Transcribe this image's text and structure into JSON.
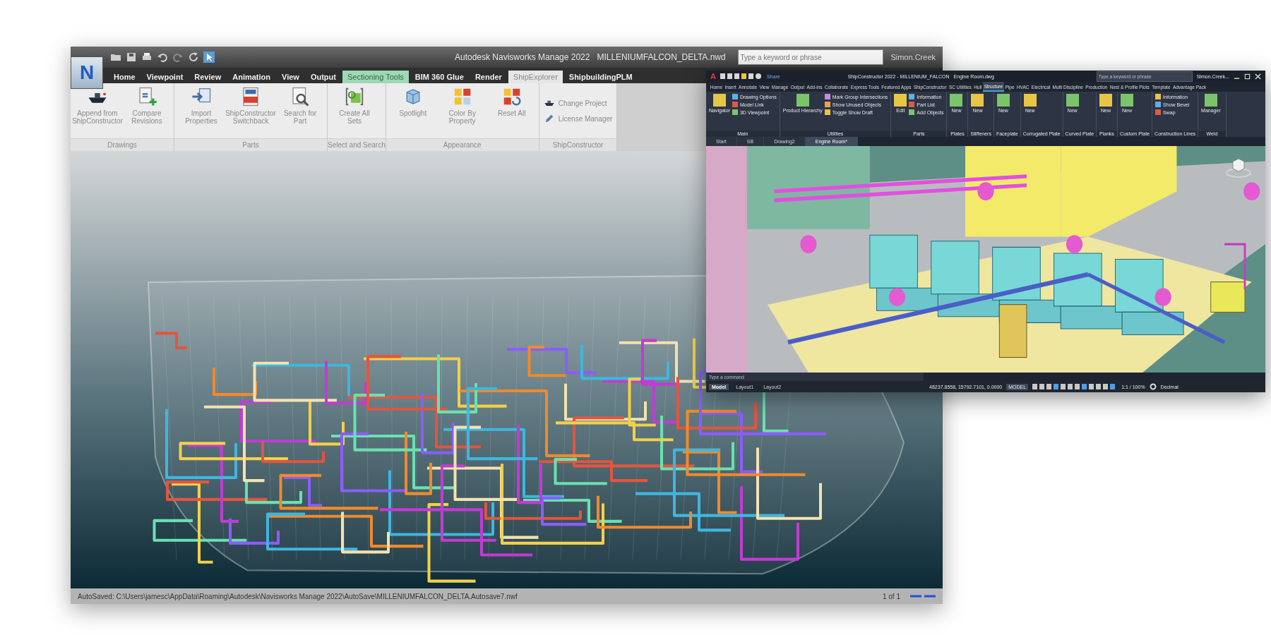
{
  "navisworks": {
    "app_button": "N",
    "title": "Autodesk Navisworks Manage 2022",
    "file": "MILLENIUMFALCON_DELTA.nwd",
    "search": {
      "placeholder": "Type a keyword or phrase"
    },
    "user": "Simon.Creek",
    "tabs": [
      {
        "label": "Home",
        "kind": "normal",
        "selected": false
      },
      {
        "label": "Viewpoint",
        "kind": "normal",
        "selected": false
      },
      {
        "label": "Review",
        "kind": "normal",
        "selected": false
      },
      {
        "label": "Animation",
        "kind": "normal",
        "selected": false
      },
      {
        "label": "View",
        "kind": "normal",
        "selected": false
      },
      {
        "label": "Output",
        "kind": "normal",
        "selected": false
      },
      {
        "label": "Sectioning Tools",
        "kind": "contextual",
        "selected": false
      },
      {
        "label": "BIM 360 Glue",
        "kind": "normal",
        "selected": false
      },
      {
        "label": "Render",
        "kind": "normal",
        "selected": false
      },
      {
        "label": "ShipExplorer",
        "kind": "normal",
        "selected": true
      },
      {
        "label": "ShipbuildingPLM",
        "kind": "normal",
        "selected": false
      }
    ],
    "panels": [
      {
        "title": "Drawings",
        "kind": "large",
        "buttons": [
          {
            "label": "Append from ShipConstructor",
            "kind": "ship"
          },
          {
            "label": "Compare Revisions",
            "kind": "compare"
          }
        ]
      },
      {
        "title": "Parts",
        "kind": "large",
        "buttons": [
          {
            "label": "Import Properties",
            "kind": "import"
          },
          {
            "label": "ShipConstructor Switchback",
            "kind": "switchback"
          },
          {
            "label": "Search for Part",
            "kind": "search"
          }
        ]
      },
      {
        "title": "Select and Search",
        "kind": "large",
        "buttons": [
          {
            "label": "Create All Sets",
            "kind": "sets"
          }
        ]
      },
      {
        "title": "Appearance",
        "kind": "large",
        "buttons": [
          {
            "label": "Spotlight",
            "kind": "spotlight"
          },
          {
            "label": "Color By Property",
            "kind": "color"
          },
          {
            "label": "Reset All",
            "kind": "reset"
          }
        ]
      },
      {
        "title": "ShipConstructor",
        "kind": "small",
        "buttons": [
          {
            "label": "Change Project",
            "kind": "project"
          },
          {
            "label": "License Manager",
            "kind": "license"
          }
        ]
      }
    ],
    "status": {
      "path": "AutoSaved: C:\\Users\\jamesc\\AppData\\Roaming\\Autodesk\\Navisworks Manage 2022\\AutoSave\\MILLENIUMFALCON_DELTA.Autosave7.nwf",
      "page": "1 of 1"
    }
  },
  "shipconstructor": {
    "app_button": "A",
    "share": "Share",
    "title": "ShipConstructor 2022 - MILLENIUM_FALCON",
    "file": "Engine Room.dwg",
    "search": {
      "placeholder": "Type a keyword or phrase"
    },
    "user": "Simon.Creek...",
    "tabs": [
      {
        "label": "Home",
        "selected": false
      },
      {
        "label": "Insert",
        "selected": false
      },
      {
        "label": "Annotate",
        "selected": false
      },
      {
        "label": "View",
        "selected": false
      },
      {
        "label": "Manage",
        "selected": false
      },
      {
        "label": "Output",
        "selected": false
      },
      {
        "label": "Add-ins",
        "selected": false
      },
      {
        "label": "Collaborate",
        "selected": false
      },
      {
        "label": "Express Tools",
        "selected": false
      },
      {
        "label": "Featured Apps",
        "selected": false
      },
      {
        "label": "ShipConstructor",
        "selected": false
      },
      {
        "label": "SC Utilities",
        "selected": false
      },
      {
        "label": "Hull",
        "selected": false
      },
      {
        "label": "Structure",
        "selected": true
      },
      {
        "label": "Pipe",
        "selected": false
      },
      {
        "label": "HVAC",
        "selected": false
      },
      {
        "label": "Electrical",
        "selected": false
      },
      {
        "label": "Multi Discipline",
        "selected": false
      },
      {
        "label": "Production",
        "selected": false
      },
      {
        "label": "Nest & Profile Plots",
        "selected": false
      },
      {
        "label": "Template",
        "selected": false
      },
      {
        "label": "Advantage Pack",
        "selected": false
      }
    ],
    "panels": [
      {
        "title": "Main",
        "buttons": [
          {
            "label": "Navigator",
            "kind": "large"
          },
          {
            "label": "Drawing Options",
            "kind": "small"
          },
          {
            "label": "Model Link",
            "kind": "small"
          },
          {
            "label": "3D Viewpoint",
            "kind": "small"
          }
        ]
      },
      {
        "title": "Utilities",
        "buttons": [
          {
            "label": "Product Hierarchy",
            "kind": "large"
          },
          {
            "label": "Mark Group Intersections",
            "kind": "small"
          },
          {
            "label": "Show Unused Objects",
            "kind": "small"
          },
          {
            "label": "Toggle Show Draft",
            "kind": "small"
          }
        ]
      },
      {
        "title": "Parts",
        "buttons": [
          {
            "label": "Edit",
            "kind": "large"
          },
          {
            "label": "Information",
            "kind": "small"
          },
          {
            "label": "Part List",
            "kind": "small"
          },
          {
            "label": "Add Objects",
            "kind": "small"
          }
        ]
      },
      {
        "title": "Plates",
        "buttons": [
          {
            "label": "New",
            "kind": "large"
          }
        ]
      },
      {
        "title": "Stiffeners",
        "buttons": [
          {
            "label": "New",
            "kind": "large"
          }
        ]
      },
      {
        "title": "Faceplate",
        "buttons": [
          {
            "label": "New",
            "kind": "large"
          }
        ]
      },
      {
        "title": "Corrugated Plate",
        "buttons": [
          {
            "label": "New",
            "kind": "large"
          }
        ]
      },
      {
        "title": "Curved Plate",
        "buttons": [
          {
            "label": "New",
            "kind": "large"
          }
        ]
      },
      {
        "title": "Planks",
        "buttons": [
          {
            "label": "New",
            "kind": "large"
          }
        ]
      },
      {
        "title": "Custom Plate",
        "buttons": [
          {
            "label": "New",
            "kind": "large"
          }
        ]
      },
      {
        "title": "Construction Lines",
        "buttons": [
          {
            "label": "Information",
            "kind": "small"
          },
          {
            "label": "Show Bevel",
            "kind": "small"
          },
          {
            "label": "Swap",
            "kind": "small"
          }
        ]
      },
      {
        "title": "Weld",
        "buttons": [
          {
            "label": "Manager",
            "kind": "large"
          }
        ]
      }
    ],
    "doc_tabs": [
      {
        "label": "Start",
        "selected": false
      },
      {
        "label": "SB",
        "selected": false
      },
      {
        "label": "Drawing2",
        "selected": false
      },
      {
        "label": "Engine Room*",
        "selected": true
      }
    ],
    "command": {
      "placeholder": "Type a command"
    },
    "layout_tabs": [
      {
        "label": "Model",
        "selected": true
      },
      {
        "label": "Layout1",
        "selected": false
      },
      {
        "label": "Layout2",
        "selected": false
      }
    ],
    "status": {
      "coordinates": "48237.8558, 15792.7101, 0.0000",
      "mode": "MODEL",
      "scale": "1:1 / 100%",
      "units": "Decimal"
    }
  }
}
